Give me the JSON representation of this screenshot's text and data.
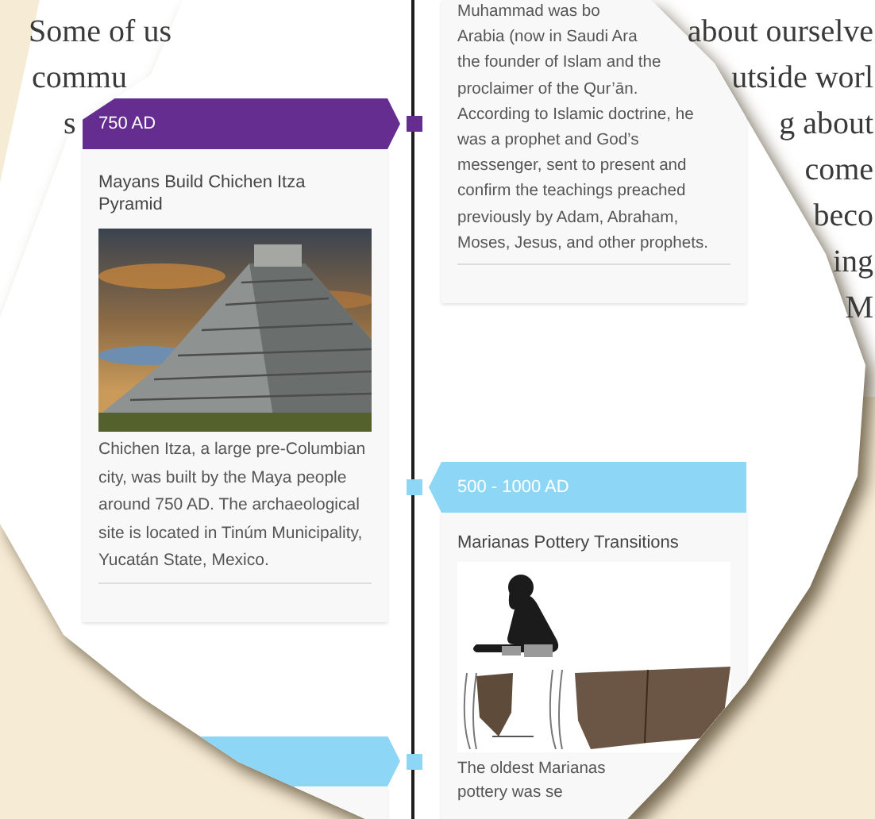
{
  "background_text": {
    "left_lines": [
      "Some of us",
      "commu",
      "s"
    ],
    "right_lines": [
      "about ourselve",
      "utside worl",
      "g about",
      "come",
      "beco",
      "ing",
      "M"
    ]
  },
  "right_events": [
    {
      "kind": "text",
      "lines": [
        "Muhammad was bo",
        "Arabia (now in Saudi Ara",
        "the founder of Islam and the",
        "proclaimer of the Qur’ān.",
        "According to Islamic doctrine, he",
        "was a prophet and God’s",
        "messenger, sent to present and",
        "confirm the teachings preached",
        "previously by Adam, Abraham,",
        "Moses, Jesus, and other prophets."
      ]
    },
    {
      "kind": "drawing",
      "date": "500 - 1000 AD",
      "color": "#8dd6f5",
      "title": "Marianas Pottery Transitions",
      "lines": [
        "The oldest Marianas",
        "pottery was se"
      ]
    }
  ],
  "left_events": [
    {
      "kind": "photo",
      "date": "750 AD",
      "color": "#662d91",
      "title": "Mayans Build Chichen Itza Pyramid",
      "description": "Chichen Itza, a large pre-Columbian city, was built by the Maya people around 750 AD. The archaeological site is located in Tinúm Municipality, Yucatán State, Mexico."
    },
    {
      "kind": "empty",
      "color": "#8dd6f5"
    }
  ]
}
